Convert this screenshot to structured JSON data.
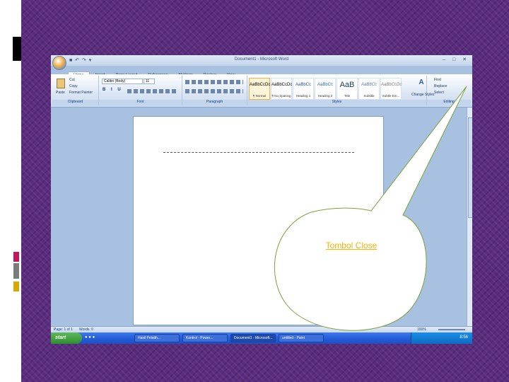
{
  "window": {
    "title": "Document1 - Microsoft Word",
    "quick_access": "■ ↶ ↷ ▾",
    "controls": "– □ ✕"
  },
  "tabs": [
    "Home",
    "Insert",
    "Page Layout",
    "References",
    "Mailings",
    "Review",
    "View"
  ],
  "clipboard": {
    "paste": "Paste",
    "cut": "Cut",
    "copy": "Copy",
    "format_painter": "Format Painter",
    "label": "Clipboard"
  },
  "font": {
    "family": "Calibri (Body)",
    "size": "11",
    "label": "Font"
  },
  "paragraph": {
    "label": "Paragraph"
  },
  "styles": {
    "items": [
      {
        "sample": "AaBbCcDc",
        "name": "¶ Normal"
      },
      {
        "sample": "AaBbCcDc",
        "name": "¶ No Spacing"
      },
      {
        "sample": "AaBbCc",
        "name": "Heading 1"
      },
      {
        "sample": "AaBbCc",
        "name": "Heading 2"
      },
      {
        "sample": "AaB",
        "name": "Title"
      },
      {
        "sample": "AaBbCc",
        "name": "Subtitle"
      },
      {
        "sample": "AaBbCcDc",
        "name": "Subtle Em..."
      }
    ],
    "change_styles": "Change Styles",
    "label": "Styles"
  },
  "editing": {
    "find": "Find",
    "replace": "Replace",
    "select": "Select",
    "label": "Editing"
  },
  "status": {
    "page": "Page: 1 of 1",
    "words": "Words: 0",
    "zoom": "100%"
  },
  "taskbar": {
    "start": "start",
    "items": [
      "Hasil Pelatih...",
      "Kontrol - Power...",
      "Document1 - Microsoft...",
      "untitled - Paint"
    ],
    "clock": "8:56"
  },
  "callout": {
    "label": "Tombol Close"
  }
}
